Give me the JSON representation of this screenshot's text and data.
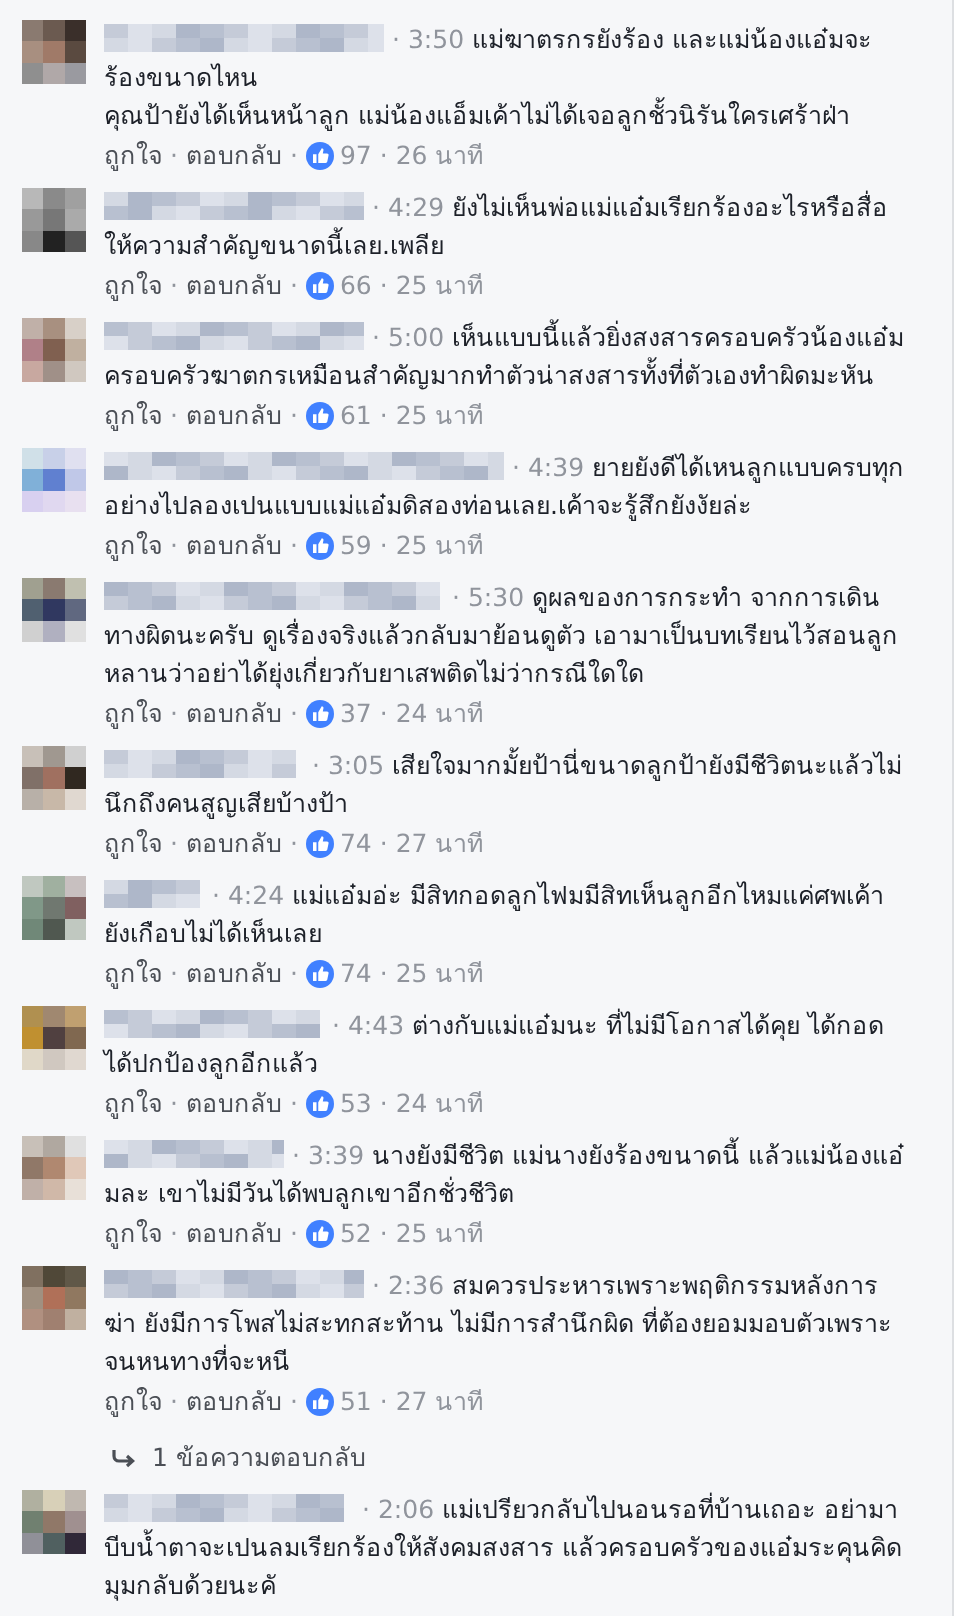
{
  "separator": "·",
  "comments": [
    {
      "time": "3:50",
      "text": "แม่ฆาตรกรยังร้อง และแม่น้องแอ๋มจะร้องขนาดไหน\nคุณป้ายังได้เห็นหน้าลูก แม่น้องแอ็มเค้าไม่ได้เจอลูกชั้วนิรันใครเศร้าฝ่า",
      "actions": [
        "ถูกใจ",
        "ตอบกลับ"
      ],
      "likes": "97",
      "age": "26 นาที"
    },
    {
      "time": "4:29",
      "text": "ยังไม่เห็นพ่อแม่แอ๋มเรียกร้องอะไรหรือสื่อให้ความสำคัญขนาดนี้เลย.เพลีย",
      "actions": [
        "ถูกใจ",
        "ตอบกลับ"
      ],
      "likes": "66",
      "age": "25 นาที"
    },
    {
      "time": "5:00",
      "text": "เห็นแบบนี้แล้วยิ่งสงสารครอบครัวน้องแอ๋ม ครอบครัวฆาตกรเหมือนสำคัญมากทำตัวน่าสงสารทั้งที่ตัวเองทำผิดมะหัน",
      "actions": [
        "ถูกใจ",
        "ตอบกลับ"
      ],
      "likes": "61",
      "age": "25 นาที"
    },
    {
      "time": "4:39",
      "text": "ยายยังดีได้เหนลูกแบบครบทุกอย่างไปลองเปนแบบแม่แอ๋มดิสองท่อนเลย.เค้าจะรู้สึกยังงัยล่ะ",
      "actions": [
        "ถูกใจ",
        "ตอบกลับ"
      ],
      "likes": "59",
      "age": "25 นาที"
    },
    {
      "time": "5:30",
      "text": "ดูผลของการกระทำ จากการเดินทางผิดนะครับ ดูเรื่องจริงแล้วกลับมาย้อนดูตัว เอามาเป็นบทเรียนไว้สอนลูกหลานว่าอย่าได้ยุ่งเกี่ยวกับยาเสพติดไม่ว่ากรณีใดใด",
      "actions": [
        "ถูกใจ",
        "ตอบกลับ"
      ],
      "likes": "37",
      "age": "24 นาที"
    },
    {
      "time": "3:05",
      "text": "เสียใจมากมั้ยป้านี่ขนาดลูกป้ายังมีชีวิตนะแล้วไม่นึกถึงคนสูญเสียบ้างป้า",
      "actions": [
        "ถูกใจ",
        "ตอบกลับ"
      ],
      "likes": "74",
      "age": "27 นาที"
    },
    {
      "time": "4:24",
      "text": "แม่แอ๋มอ่ะ มีสิทกอดลูกไฟมมีสิทเห็นลูกอีกไหมแค่ศพเค้ายังเกือบไม่ได้เห็นเลย",
      "actions": [
        "ถูกใจ",
        "ตอบกลับ"
      ],
      "likes": "74",
      "age": "25 นาที"
    },
    {
      "time": "4:43",
      "text": "ต่างกับแม่แอ๋มนะ ที่ไม่มีโอกาสได้คุย ได้กอด ได้ปกป้องลูกอีกแล้ว",
      "actions": [
        "ถูกใจ",
        "ตอบกลับ"
      ],
      "likes": "53",
      "age": "24 นาที"
    },
    {
      "time": "3:39",
      "text": "นางยังมีชีวิต แม่นางยังร้องขนาดนี้ แล้วแม่น้องแอ๋มละ เขาไม่มีวันได้พบลูกเขาอีกชั่วชีวิต",
      "actions": [
        "ถูกใจ",
        "ตอบกลับ"
      ],
      "likes": "52",
      "age": "25 นาที"
    },
    {
      "time": "2:36",
      "text": "สมควรประหารเพราะพฤติกรรมหลังการฆ่า ยังมีการโพสไม่สะทกสะท้าน ไม่มีการสำนึกผิด ที่ต้องยอมมอบตัวเพราะจนหนทางที่จะหนี",
      "actions": [
        "ถูกใจ",
        "ตอบกลับ"
      ],
      "likes": "51",
      "age": "27 นาที",
      "replies": "1 ข้อความตอบกลับ"
    },
    {
      "time": "2:06",
      "text": "แม่เปรียวกลับไปนอนรอที่บ้านเถอะ อย่ามาบีบน้ำตาจะเปนลมเรียกร้องให้สังคมสงสาร แล้วครอบครัวของแอ๋มระคุนคิดมุมกลับด้วยนะคั"
    }
  ]
}
